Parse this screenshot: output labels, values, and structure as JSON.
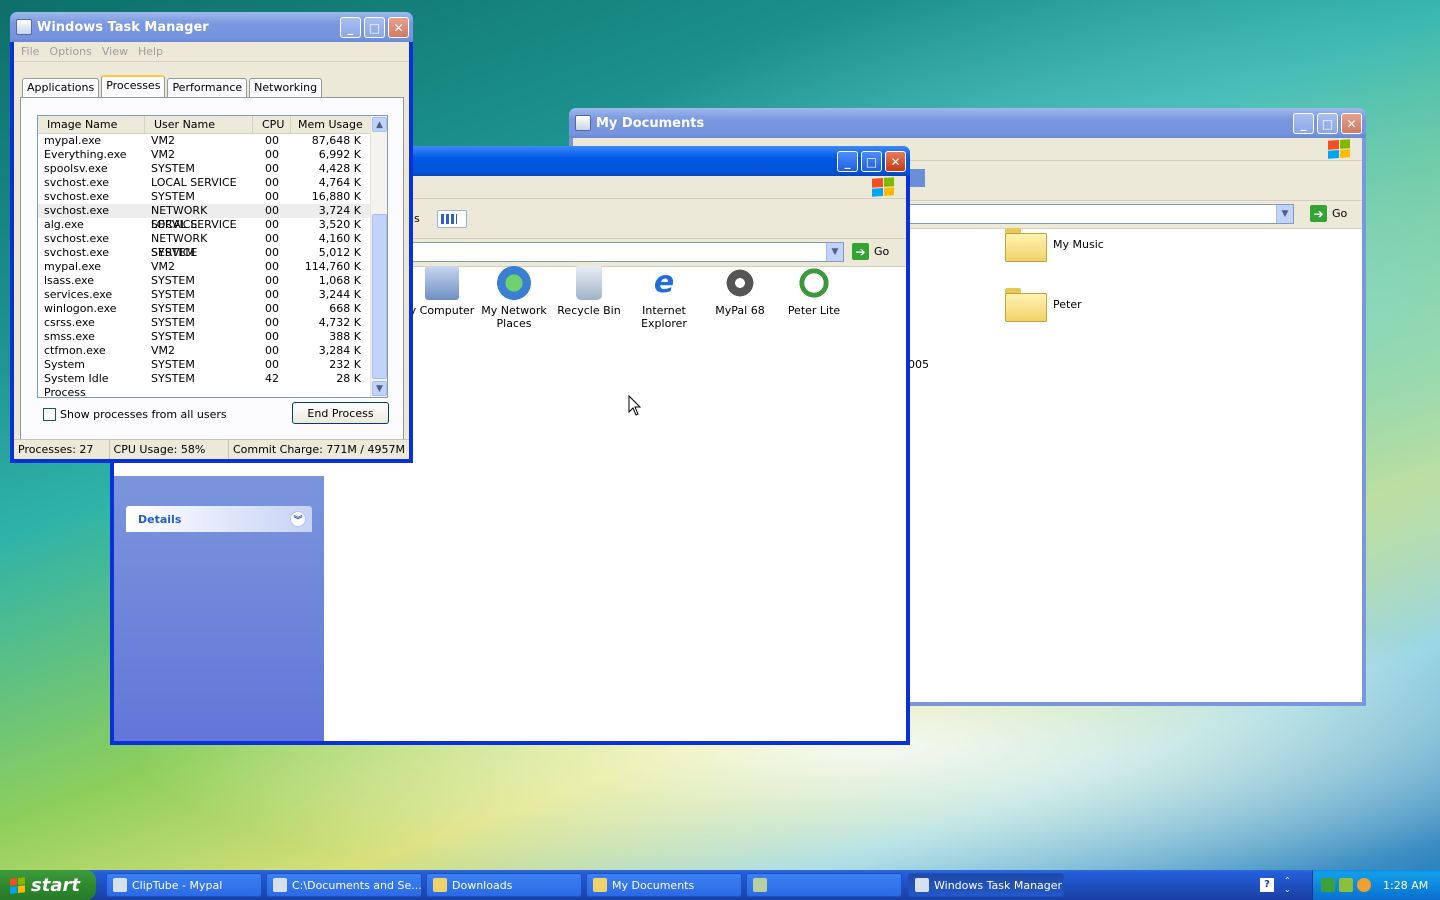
{
  "task_manager": {
    "title": "Windows Task Manager",
    "menu": [
      "File",
      "Options",
      "View",
      "Help"
    ],
    "tabs": [
      "Applications",
      "Processes",
      "Performance",
      "Networking"
    ],
    "active_tab": "Processes",
    "columns": [
      "Image Name",
      "User Name",
      "CPU",
      "Mem Usage"
    ],
    "processes": [
      [
        "mypal.exe",
        "VM2",
        "00",
        "87,648 K"
      ],
      [
        "Everything.exe",
        "VM2",
        "00",
        "6,992 K"
      ],
      [
        "spoolsv.exe",
        "SYSTEM",
        "00",
        "4,428 K"
      ],
      [
        "svchost.exe",
        "LOCAL SERVICE",
        "00",
        "4,764 K"
      ],
      [
        "svchost.exe",
        "SYSTEM",
        "00",
        "16,880 K"
      ],
      [
        "svchost.exe",
        "NETWORK SERVICE",
        "00",
        "3,724 K"
      ],
      [
        "alg.exe",
        "LOCAL SERVICE",
        "00",
        "3,520 K"
      ],
      [
        "svchost.exe",
        "NETWORK SERVICE",
        "00",
        "4,160 K"
      ],
      [
        "svchost.exe",
        "SYSTEM",
        "00",
        "5,012 K"
      ],
      [
        "mypal.exe",
        "VM2",
        "00",
        "114,760 K"
      ],
      [
        "lsass.exe",
        "SYSTEM",
        "00",
        "1,068 K"
      ],
      [
        "services.exe",
        "SYSTEM",
        "00",
        "3,244 K"
      ],
      [
        "winlogon.exe",
        "SYSTEM",
        "00",
        "668 K"
      ],
      [
        "csrss.exe",
        "SYSTEM",
        "00",
        "4,732 K"
      ],
      [
        "smss.exe",
        "SYSTEM",
        "00",
        "388 K"
      ],
      [
        "ctfmon.exe",
        "VM2",
        "00",
        "3,284 K"
      ],
      [
        "System",
        "SYSTEM",
        "00",
        "232 K"
      ],
      [
        "System Idle Process",
        "SYSTEM",
        "42",
        "28 K"
      ]
    ],
    "selected_row": 5,
    "show_all_label": "Show processes from all users",
    "end_process_label": "End Process",
    "status": {
      "processes": "Processes: 27",
      "cpu": "CPU Usage: 58%",
      "commit": "Commit Charge: 771M / 4957M"
    }
  },
  "my_documents": {
    "title": "My Documents",
    "go_label": "Go",
    "items": [
      {
        "label": "My Music",
        "icon": "music-folder-icon"
      },
      {
        "label": "Peter",
        "icon": "folder-icon"
      }
    ],
    "partial_text": "005"
  },
  "front_explorer": {
    "toolbar_partial": "s",
    "go_label": "Go",
    "details_label": "Details",
    "icons": [
      {
        "label": "y Computer",
        "icon": "my-computer-icon"
      },
      {
        "label": "My Network Places",
        "icon": "network-places-icon"
      },
      {
        "label": "Recycle Bin",
        "icon": "recycle-bin-icon"
      },
      {
        "label": "Internet Explorer",
        "icon": "internet-explorer-icon"
      },
      {
        "label": "MyPal 68",
        "icon": "mypal-icon"
      },
      {
        "label": "Peter Lite",
        "icon": "peter-lite-icon"
      }
    ]
  },
  "taskbar": {
    "start_label": "start",
    "items": [
      {
        "label": "ClipTube - Mypal",
        "active": false
      },
      {
        "label": "C:\\Documents and Se...",
        "active": false
      },
      {
        "label": "Downloads",
        "active": false
      },
      {
        "label": "My Documents",
        "active": false
      },
      {
        "label": "",
        "active": false
      },
      {
        "label": "Windows Task Manager",
        "active": true
      }
    ],
    "clock": "1:28 AM"
  }
}
